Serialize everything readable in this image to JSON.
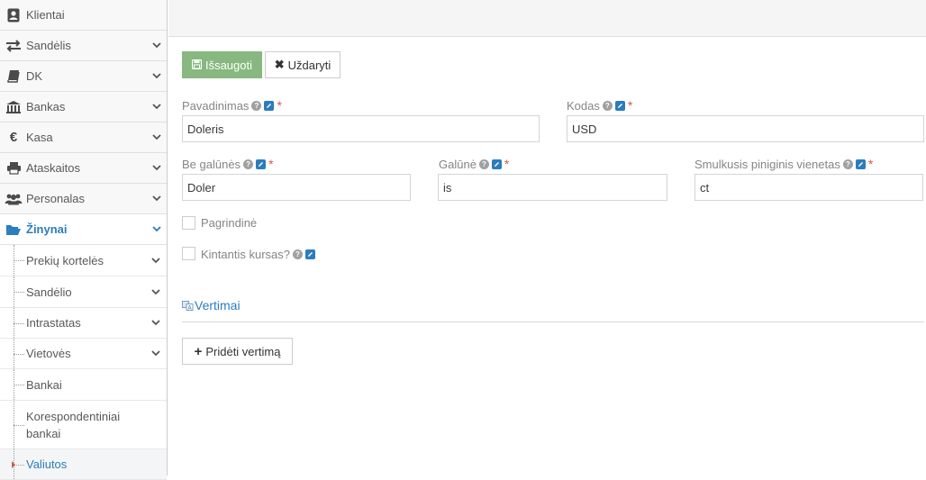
{
  "sidebar": {
    "items": [
      {
        "label": "Klientai",
        "icon": "user-card-icon",
        "has_chevron": false
      },
      {
        "label": "Sandėlis",
        "icon": "exchange-icon",
        "has_chevron": true
      },
      {
        "label": "DK",
        "icon": "book-icon",
        "has_chevron": true
      },
      {
        "label": "Bankas",
        "icon": "bank-icon",
        "has_chevron": true
      },
      {
        "label": "Kasa",
        "icon": "euro-icon",
        "has_chevron": true
      },
      {
        "label": "Ataskaitos",
        "icon": "printer-icon",
        "has_chevron": true
      },
      {
        "label": "Personalas",
        "icon": "users-icon",
        "has_chevron": true
      },
      {
        "label": "Žinynai",
        "icon": "folder-open-icon",
        "has_chevron": true,
        "active": true
      }
    ],
    "sub_items": [
      {
        "label": "Prekių kortelės",
        "has_chevron": true
      },
      {
        "label": "Sandėlio",
        "has_chevron": true
      },
      {
        "label": "Intrastatas",
        "has_chevron": true
      },
      {
        "label": "Vietovės",
        "has_chevron": true
      },
      {
        "label": "Bankai",
        "has_chevron": false
      },
      {
        "label": "Korespondentiniai bankai",
        "has_chevron": false
      },
      {
        "label": "Valiutos",
        "has_chevron": false,
        "current": true
      }
    ]
  },
  "toolbar": {
    "save_label": "Išsaugoti",
    "close_label": "Uždaryti"
  },
  "form": {
    "name": {
      "label": "Pavadinimas",
      "value": "Doleris"
    },
    "code": {
      "label": "Kodas",
      "value": "USD"
    },
    "without_ending": {
      "label": "Be galūnės",
      "value": "Doler"
    },
    "ending": {
      "label": "Galūnė",
      "value": "is"
    },
    "minor_unit": {
      "label": "Smulkusis piniginis vienetas",
      "value": "ct"
    },
    "primary": {
      "label": "Pagrindinė"
    },
    "floating_rate": {
      "label": "Kintantis kursas?"
    },
    "required_mark": "*"
  },
  "translations": {
    "title": "Vertimai",
    "add_label": "Pridėti vertimą"
  },
  "colors": {
    "accent": "#2b7dbc",
    "save_button": "#87b87f",
    "required": "#d9534f"
  }
}
